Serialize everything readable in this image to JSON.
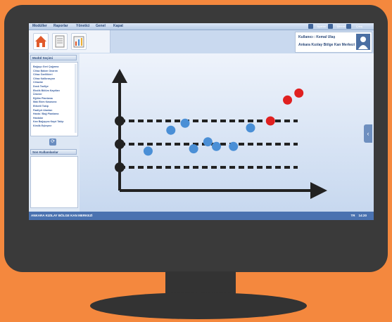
{
  "menubar": {
    "items": [
      "Modüller",
      "Raporlar",
      "Yönetici",
      "Genel"
    ],
    "close_label": "Kapat"
  },
  "top_right": {
    "items": [
      "Ayarlar",
      "Şifremi",
      "Çıkış"
    ]
  },
  "user": {
    "line1": "Kullanıcı : Kemal Ulaş",
    "line2": "Ankara Kızılay Bölge Kan Merkezi"
  },
  "left_panel": {
    "module_header": "Modül Seçimi",
    "modules": [
      "Bağışçı Geri Çağırma",
      "Cihaz Bakım Onarım",
      "Cihaz Özellikleri",
      "Cihaz Kalibrasyon",
      "Cihazlar",
      "Dosk Tasfiye",
      "Ekstik Bölüm Kayıtları",
      "Ürünler",
      "Eğitim Planlama",
      "Mak Ekim Kasasına",
      "Etiketli Takip",
      "Faaliyet Alanları",
      "Hasta / Bağ Planlama",
      "Hastalar",
      "Kan Bağışçısı Kayıt Takip",
      "Kimlik Eşleşme"
    ],
    "history_header": "Son Kullanılanlar",
    "refresh_icon": "refresh-icon"
  },
  "statusbar": {
    "left": "ANKARA KIZILAY BÖLGE KAN MERKEZİ",
    "lang": "TR",
    "time": "14:20"
  },
  "chart_data": {
    "type": "scatter",
    "title": "",
    "xlabel": "",
    "ylabel": "",
    "series": [
      {
        "color": "#4A8FD6",
        "points": [
          [
            1.0,
            1.7
          ],
          [
            1.8,
            2.6
          ],
          [
            2.3,
            2.9
          ],
          [
            2.6,
            1.8
          ],
          [
            3.1,
            2.1
          ],
          [
            3.4,
            1.9
          ],
          [
            4.0,
            1.9
          ],
          [
            4.6,
            2.7
          ]
        ]
      },
      {
        "color": "#E02020",
        "points": [
          [
            5.3,
            3.0
          ],
          [
            5.9,
            3.9
          ],
          [
            6.3,
            4.2
          ]
        ]
      }
    ],
    "reference_levels": [
      1,
      2,
      3
    ],
    "colors": {
      "blue": "#4A8FD6",
      "red": "#E02020",
      "ink": "#222222"
    }
  }
}
